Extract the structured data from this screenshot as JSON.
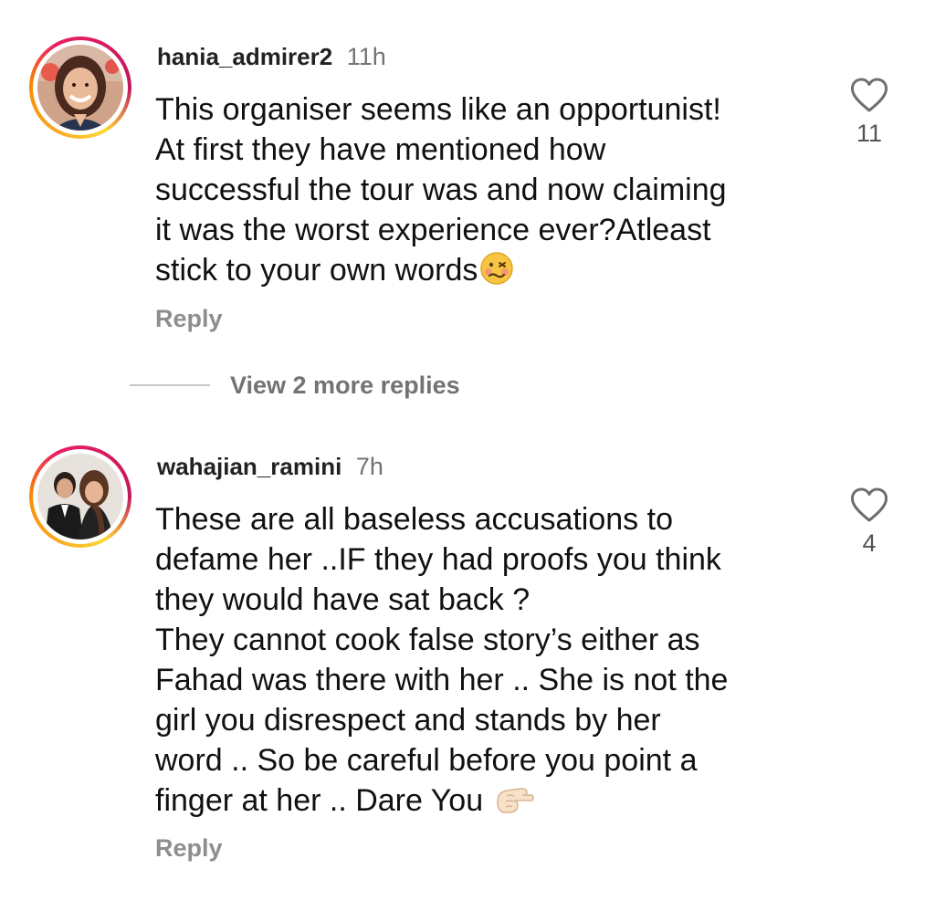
{
  "comments": [
    {
      "username": "hania_admirer2",
      "time": "11h",
      "lines": [
        "This organiser seems like an opportunist!",
        "At first they have mentioned how",
        "successful the tour was and now claiming",
        "it was the worst experience ever?Atleast",
        "stick to your own words"
      ],
      "trailing_emoji": "woozy-face-emoji",
      "likes": "11",
      "reply_label": "Reply",
      "avatar": "profile-photo-woman-smiling"
    },
    {
      "username": "wahajian_ramini",
      "time": "7h",
      "lines": [
        "These are all baseless accusations to",
        "defame her ..IF they had proofs you think",
        "they would have sat back ?",
        "They cannot cook false story’s either as",
        "Fahad was there with her .. She is not the",
        "girl you disrespect and stands by her",
        "word .. So be careful before you point a",
        "finger at her .. Dare You"
      ],
      "trailing_emoji": "pointing-finger-emoji",
      "likes": "4",
      "reply_label": "Reply",
      "avatar": "profile-photo-couple"
    }
  ],
  "view_replies": "View 2 more replies",
  "colors": {
    "text": "#111111",
    "muted": "#8e8e8e",
    "ring_start": "#f9a825",
    "ring_end": "#d81b60"
  },
  "icons": [
    "heart-icon"
  ]
}
